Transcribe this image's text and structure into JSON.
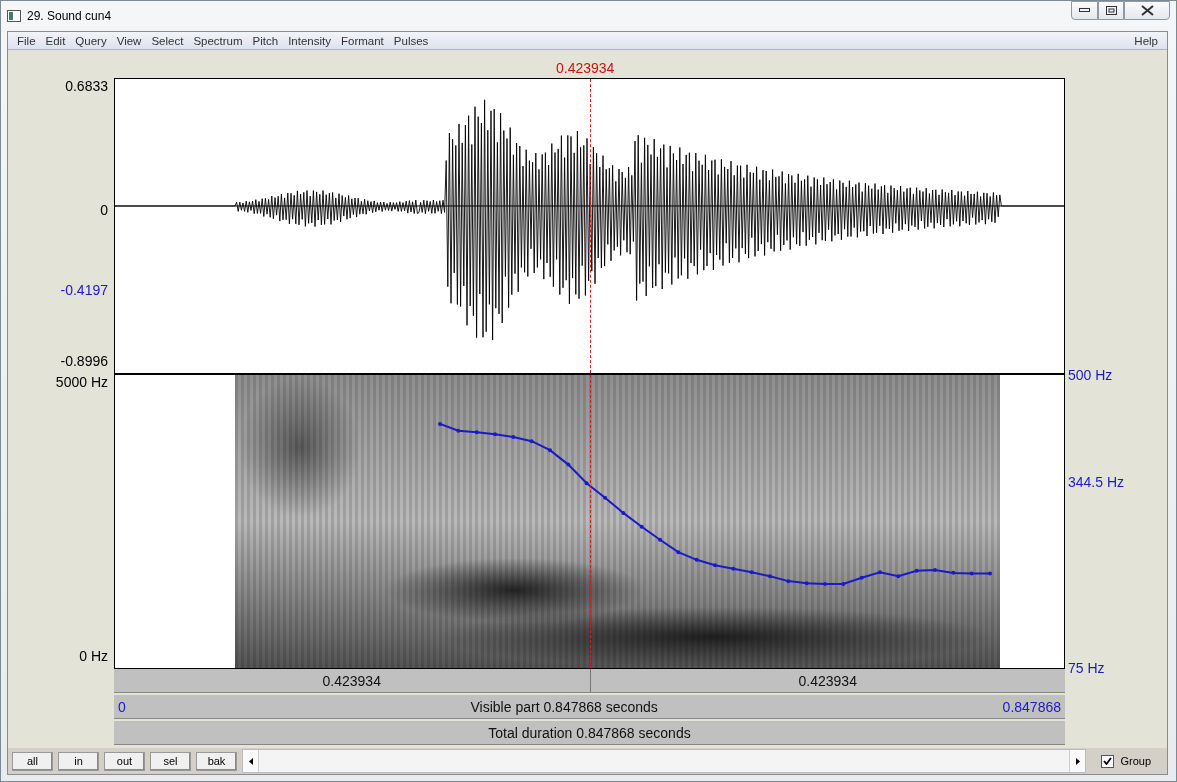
{
  "window": {
    "title": "29. Sound cun4"
  },
  "menu": {
    "items": [
      "File",
      "Edit",
      "Query",
      "View",
      "Select",
      "Spectrum",
      "Pitch",
      "Intensity",
      "Formant",
      "Pulses"
    ],
    "help": "Help"
  },
  "cursor": {
    "time": "0.423934"
  },
  "waveform": {
    "axis_labels": [
      {
        "text": "0.6833",
        "kind": "top"
      },
      {
        "text": "0",
        "kind": "zero"
      },
      {
        "text": "-0.4197",
        "kind": "cursor"
      },
      {
        "text": "-0.8996",
        "kind": "bottom"
      }
    ]
  },
  "spectrogram": {
    "left_labels": [
      {
        "text": "5000 Hz",
        "kind": "top"
      },
      {
        "text": "0 Hz",
        "kind": "bottom"
      }
    ],
    "chart_data": {
      "type": "line",
      "ylim": [
        75,
        500
      ],
      "yticks": [
        {
          "value": 500,
          "label": "500 Hz"
        },
        {
          "value": 344.5,
          "label": "344.5 Hz"
        },
        {
          "value": 75,
          "label": "75 Hz"
        }
      ],
      "categories": [
        null,
        null,
        null,
        null,
        null,
        null,
        null,
        null,
        null,
        null,
        null,
        null,
        null,
        null,
        null,
        null,
        null,
        null,
        null,
        null,
        null,
        null,
        null,
        null,
        null,
        null,
        null,
        null,
        null,
        null,
        null
      ],
      "series": [
        {
          "color": "#1a1ac8",
          "values": [
            429,
            419,
            417,
            414,
            410,
            404,
            391,
            370,
            343,
            322,
            300,
            280,
            261,
            243,
            232,
            224,
            219,
            214,
            208,
            201,
            198,
            197,
            197,
            206,
            214,
            208,
            216,
            217,
            213,
            212,
            212
          ]
        }
      ]
    }
  },
  "time_bars": {
    "segments": [
      "0.423934",
      "0.423934"
    ],
    "visible": {
      "start": "0",
      "label": "Visible part 0.847868 seconds",
      "end": "0.847868"
    },
    "total": "Total duration 0.847868 seconds"
  },
  "toolbar": {
    "buttons": [
      "all",
      "in",
      "out",
      "sel",
      "bak"
    ],
    "group": {
      "label": "Group",
      "checked": true
    }
  }
}
